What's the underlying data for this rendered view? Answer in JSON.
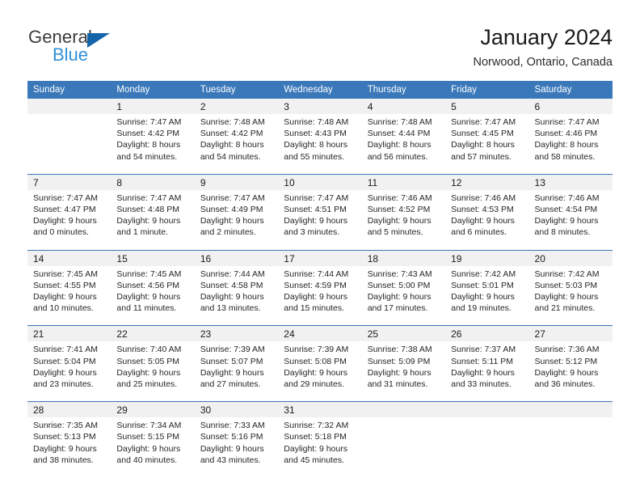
{
  "brand": {
    "name_part1": "General",
    "name_part2": "Blue",
    "accent_color": "#1464aa",
    "accent_color_light": "#2f90d8"
  },
  "header": {
    "title": "January 2024",
    "location": "Norwood, Ontario, Canada"
  },
  "theme": {
    "header_row_color": "#3a78ba",
    "daynum_band_color": "#f1f1f1"
  },
  "weekday_headers": [
    "Sunday",
    "Monday",
    "Tuesday",
    "Wednesday",
    "Thursday",
    "Friday",
    "Saturday"
  ],
  "weeks": [
    {
      "days": [
        {
          "num": "",
          "sunrise": "",
          "sunset": "",
          "daylight_line1": "",
          "daylight_line2": ""
        },
        {
          "num": "1",
          "sunrise": "Sunrise: 7:47 AM",
          "sunset": "Sunset: 4:42 PM",
          "daylight_line1": "Daylight: 8 hours",
          "daylight_line2": "and 54 minutes."
        },
        {
          "num": "2",
          "sunrise": "Sunrise: 7:48 AM",
          "sunset": "Sunset: 4:42 PM",
          "daylight_line1": "Daylight: 8 hours",
          "daylight_line2": "and 54 minutes."
        },
        {
          "num": "3",
          "sunrise": "Sunrise: 7:48 AM",
          "sunset": "Sunset: 4:43 PM",
          "daylight_line1": "Daylight: 8 hours",
          "daylight_line2": "and 55 minutes."
        },
        {
          "num": "4",
          "sunrise": "Sunrise: 7:48 AM",
          "sunset": "Sunset: 4:44 PM",
          "daylight_line1": "Daylight: 8 hours",
          "daylight_line2": "and 56 minutes."
        },
        {
          "num": "5",
          "sunrise": "Sunrise: 7:47 AM",
          "sunset": "Sunset: 4:45 PM",
          "daylight_line1": "Daylight: 8 hours",
          "daylight_line2": "and 57 minutes."
        },
        {
          "num": "6",
          "sunrise": "Sunrise: 7:47 AM",
          "sunset": "Sunset: 4:46 PM",
          "daylight_line1": "Daylight: 8 hours",
          "daylight_line2": "and 58 minutes."
        }
      ]
    },
    {
      "days": [
        {
          "num": "7",
          "sunrise": "Sunrise: 7:47 AM",
          "sunset": "Sunset: 4:47 PM",
          "daylight_line1": "Daylight: 9 hours",
          "daylight_line2": "and 0 minutes."
        },
        {
          "num": "8",
          "sunrise": "Sunrise: 7:47 AM",
          "sunset": "Sunset: 4:48 PM",
          "daylight_line1": "Daylight: 9 hours",
          "daylight_line2": "and 1 minute."
        },
        {
          "num": "9",
          "sunrise": "Sunrise: 7:47 AM",
          "sunset": "Sunset: 4:49 PM",
          "daylight_line1": "Daylight: 9 hours",
          "daylight_line2": "and 2 minutes."
        },
        {
          "num": "10",
          "sunrise": "Sunrise: 7:47 AM",
          "sunset": "Sunset: 4:51 PM",
          "daylight_line1": "Daylight: 9 hours",
          "daylight_line2": "and 3 minutes."
        },
        {
          "num": "11",
          "sunrise": "Sunrise: 7:46 AM",
          "sunset": "Sunset: 4:52 PM",
          "daylight_line1": "Daylight: 9 hours",
          "daylight_line2": "and 5 minutes."
        },
        {
          "num": "12",
          "sunrise": "Sunrise: 7:46 AM",
          "sunset": "Sunset: 4:53 PM",
          "daylight_line1": "Daylight: 9 hours",
          "daylight_line2": "and 6 minutes."
        },
        {
          "num": "13",
          "sunrise": "Sunrise: 7:46 AM",
          "sunset": "Sunset: 4:54 PM",
          "daylight_line1": "Daylight: 9 hours",
          "daylight_line2": "and 8 minutes."
        }
      ]
    },
    {
      "days": [
        {
          "num": "14",
          "sunrise": "Sunrise: 7:45 AM",
          "sunset": "Sunset: 4:55 PM",
          "daylight_line1": "Daylight: 9 hours",
          "daylight_line2": "and 10 minutes."
        },
        {
          "num": "15",
          "sunrise": "Sunrise: 7:45 AM",
          "sunset": "Sunset: 4:56 PM",
          "daylight_line1": "Daylight: 9 hours",
          "daylight_line2": "and 11 minutes."
        },
        {
          "num": "16",
          "sunrise": "Sunrise: 7:44 AM",
          "sunset": "Sunset: 4:58 PM",
          "daylight_line1": "Daylight: 9 hours",
          "daylight_line2": "and 13 minutes."
        },
        {
          "num": "17",
          "sunrise": "Sunrise: 7:44 AM",
          "sunset": "Sunset: 4:59 PM",
          "daylight_line1": "Daylight: 9 hours",
          "daylight_line2": "and 15 minutes."
        },
        {
          "num": "18",
          "sunrise": "Sunrise: 7:43 AM",
          "sunset": "Sunset: 5:00 PM",
          "daylight_line1": "Daylight: 9 hours",
          "daylight_line2": "and 17 minutes."
        },
        {
          "num": "19",
          "sunrise": "Sunrise: 7:42 AM",
          "sunset": "Sunset: 5:01 PM",
          "daylight_line1": "Daylight: 9 hours",
          "daylight_line2": "and 19 minutes."
        },
        {
          "num": "20",
          "sunrise": "Sunrise: 7:42 AM",
          "sunset": "Sunset: 5:03 PM",
          "daylight_line1": "Daylight: 9 hours",
          "daylight_line2": "and 21 minutes."
        }
      ]
    },
    {
      "days": [
        {
          "num": "21",
          "sunrise": "Sunrise: 7:41 AM",
          "sunset": "Sunset: 5:04 PM",
          "daylight_line1": "Daylight: 9 hours",
          "daylight_line2": "and 23 minutes."
        },
        {
          "num": "22",
          "sunrise": "Sunrise: 7:40 AM",
          "sunset": "Sunset: 5:05 PM",
          "daylight_line1": "Daylight: 9 hours",
          "daylight_line2": "and 25 minutes."
        },
        {
          "num": "23",
          "sunrise": "Sunrise: 7:39 AM",
          "sunset": "Sunset: 5:07 PM",
          "daylight_line1": "Daylight: 9 hours",
          "daylight_line2": "and 27 minutes."
        },
        {
          "num": "24",
          "sunrise": "Sunrise: 7:39 AM",
          "sunset": "Sunset: 5:08 PM",
          "daylight_line1": "Daylight: 9 hours",
          "daylight_line2": "and 29 minutes."
        },
        {
          "num": "25",
          "sunrise": "Sunrise: 7:38 AM",
          "sunset": "Sunset: 5:09 PM",
          "daylight_line1": "Daylight: 9 hours",
          "daylight_line2": "and 31 minutes."
        },
        {
          "num": "26",
          "sunrise": "Sunrise: 7:37 AM",
          "sunset": "Sunset: 5:11 PM",
          "daylight_line1": "Daylight: 9 hours",
          "daylight_line2": "and 33 minutes."
        },
        {
          "num": "27",
          "sunrise": "Sunrise: 7:36 AM",
          "sunset": "Sunset: 5:12 PM",
          "daylight_line1": "Daylight: 9 hours",
          "daylight_line2": "and 36 minutes."
        }
      ]
    },
    {
      "days": [
        {
          "num": "28",
          "sunrise": "Sunrise: 7:35 AM",
          "sunset": "Sunset: 5:13 PM",
          "daylight_line1": "Daylight: 9 hours",
          "daylight_line2": "and 38 minutes."
        },
        {
          "num": "29",
          "sunrise": "Sunrise: 7:34 AM",
          "sunset": "Sunset: 5:15 PM",
          "daylight_line1": "Daylight: 9 hours",
          "daylight_line2": "and 40 minutes."
        },
        {
          "num": "30",
          "sunrise": "Sunrise: 7:33 AM",
          "sunset": "Sunset: 5:16 PM",
          "daylight_line1": "Daylight: 9 hours",
          "daylight_line2": "and 43 minutes."
        },
        {
          "num": "31",
          "sunrise": "Sunrise: 7:32 AM",
          "sunset": "Sunset: 5:18 PM",
          "daylight_line1": "Daylight: 9 hours",
          "daylight_line2": "and 45 minutes."
        },
        {
          "num": "",
          "sunrise": "",
          "sunset": "",
          "daylight_line1": "",
          "daylight_line2": ""
        },
        {
          "num": "",
          "sunrise": "",
          "sunset": "",
          "daylight_line1": "",
          "daylight_line2": ""
        },
        {
          "num": "",
          "sunrise": "",
          "sunset": "",
          "daylight_line1": "",
          "daylight_line2": ""
        }
      ]
    }
  ]
}
